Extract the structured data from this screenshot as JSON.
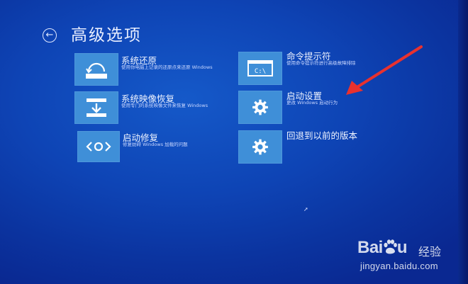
{
  "header": {
    "back_icon": "arrow-left-icon",
    "back_glyph": "←",
    "title": "高级选项"
  },
  "options": [
    {
      "title": "系统还原",
      "desc": "使用你电脑上记录的还原点来还原 Windows",
      "icon": "restore-icon"
    },
    {
      "title": "系统映像恢复",
      "desc": "使用专门的系统映像文件来恢复 Windows",
      "icon": "image-recovery-icon"
    },
    {
      "title": "启动修复",
      "desc": "修复妨碍 Windows 加载的问题",
      "icon": "startup-repair-icon"
    },
    {
      "title": "命令提示符",
      "desc": "使用命令提示符进行高级故障排除",
      "icon": "command-prompt-icon",
      "icon_text": "C:\\"
    },
    {
      "title": "启动设置",
      "desc": "更改 Windows 启动行为",
      "icon": "gear-icon"
    },
    {
      "title": "回退到以前的版本",
      "desc": "",
      "icon": "gear-icon"
    }
  ],
  "annotation": {
    "icon": "red-arrow-icon",
    "color": "#e8312f"
  },
  "watermark": {
    "brand_left": "Bai",
    "brand_right": "u",
    "brand_cn": "经验",
    "url": "jingyan.baidu.com"
  },
  "colors": {
    "background": "#0e44b5",
    "tile": "#3f8fd8",
    "text": "#eef3ff"
  }
}
